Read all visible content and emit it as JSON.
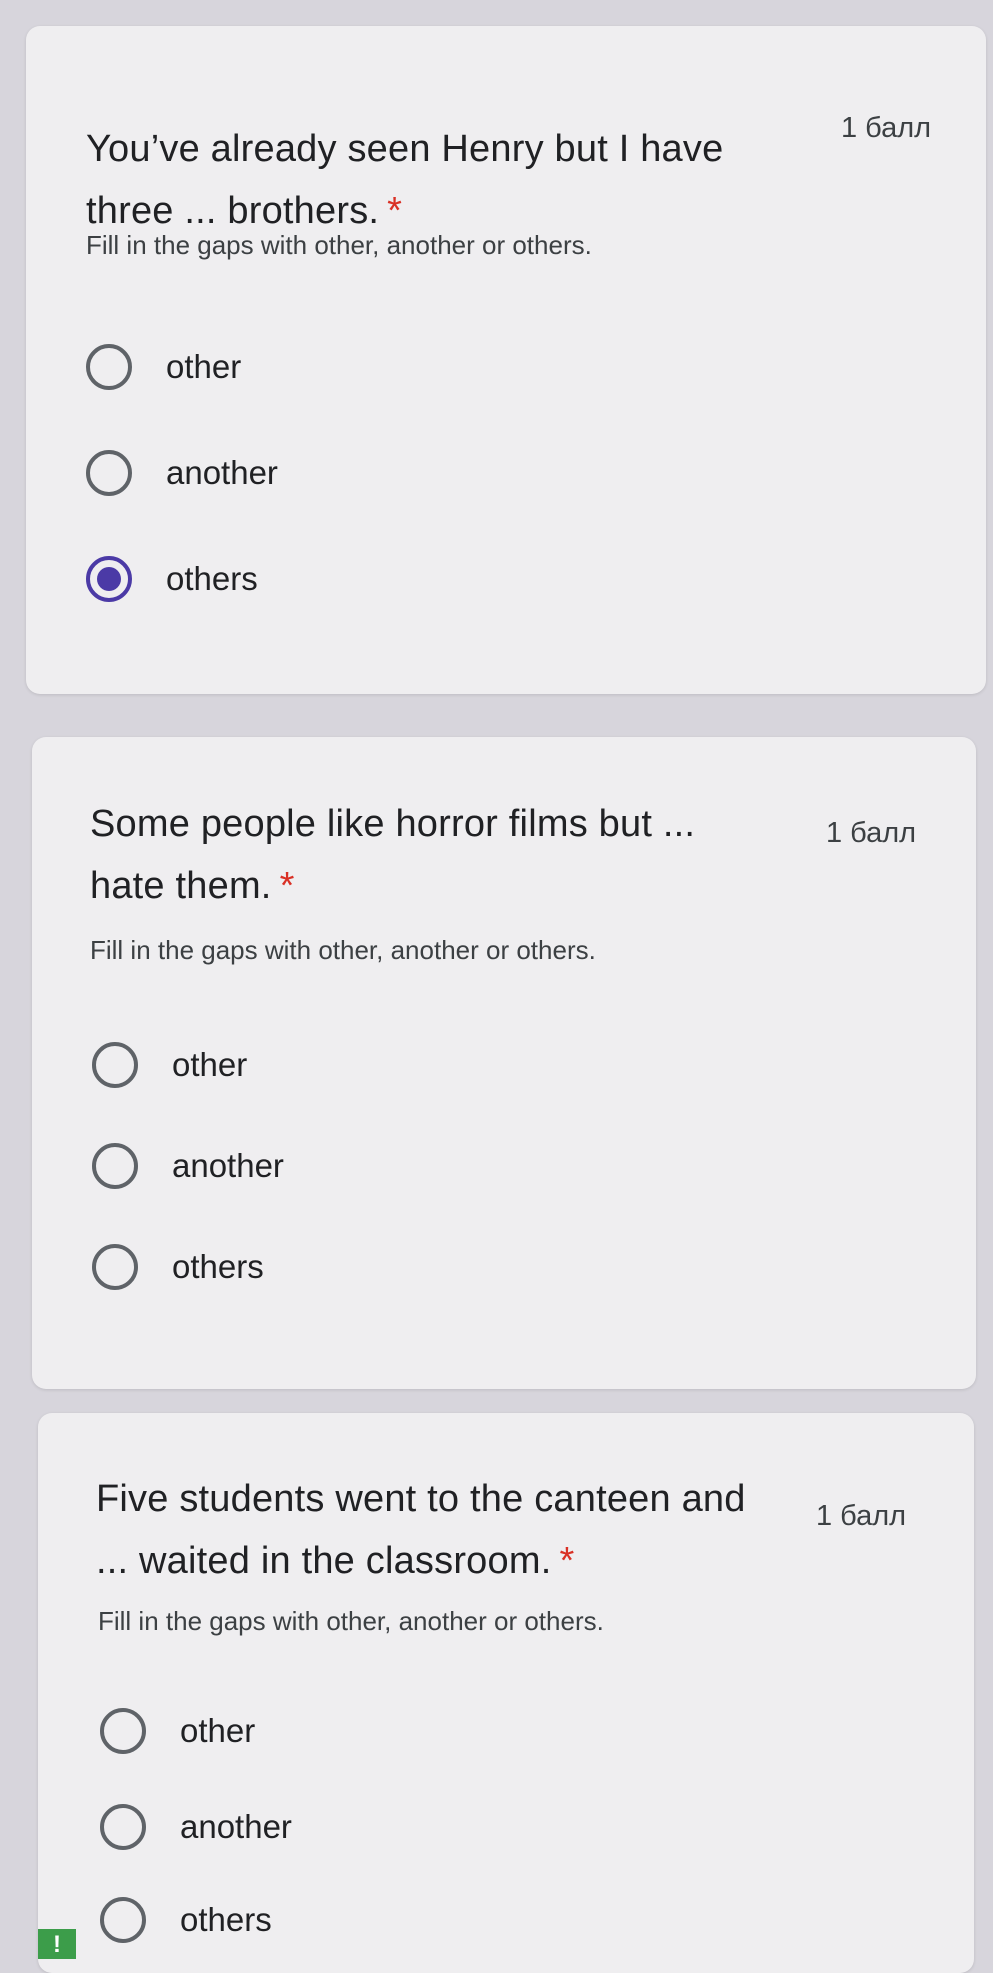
{
  "questions": [
    {
      "title_line1": "You’ve already seen Henry but I have",
      "title_line2": "three ... brothers.",
      "required_mark": "*",
      "points": "1 балл",
      "description": "Fill in the gaps with other, another or others.",
      "options": [
        "other",
        "another",
        "others"
      ],
      "selected": "others"
    },
    {
      "title_line1": "Some people like horror films but ...",
      "title_line2": "hate them.",
      "required_mark": "*",
      "points": "1 балл",
      "description": "Fill in the gaps with other, another or others.",
      "options": [
        "other",
        "another",
        "others"
      ],
      "selected": null
    },
    {
      "title_line1": "Five students went to the canteen and",
      "title_line2": "... waited in the classroom.",
      "required_mark": "*",
      "points": "1 балл",
      "description": "Fill in the gaps with other, another or others.",
      "options": [
        "other",
        "another",
        "others"
      ],
      "selected": null
    }
  ],
  "alert_badge": "!",
  "colors": {
    "accent": "#4b3aa6",
    "required": "#d93025",
    "card": "#efeef0",
    "background": "#d7d5dc"
  }
}
